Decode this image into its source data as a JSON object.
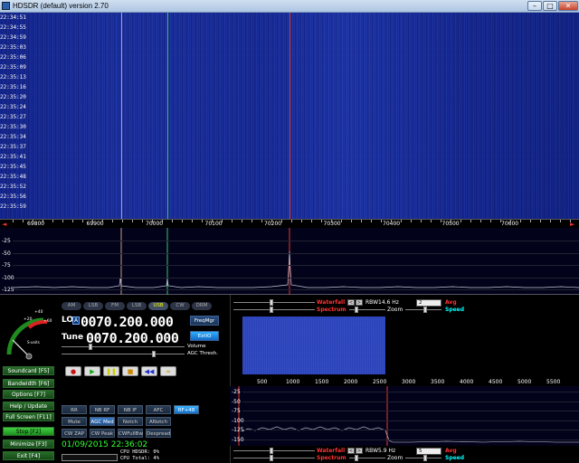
{
  "window": {
    "title": "HDSDR (default)  version 2.70"
  },
  "colors": {
    "waterfall_bg": "#0c1a74",
    "marker_tan": "#c19a7c",
    "marker_green": "#39c26a",
    "marker_red": "#e43a2a",
    "datetime_green": "#33ff33",
    "button_green": "#1d6b1f"
  },
  "waterfall": {
    "times": [
      "22:34:51",
      "22:34:55",
      "22:34:59",
      "22:35:03",
      "22:35:06",
      "22:35:09",
      "22:35:13",
      "22:35:16",
      "22:35:20",
      "22:35:24",
      "22:35:27",
      "22:35:30",
      "22:35:34",
      "22:35:37",
      "22:35:41",
      "22:35:45",
      "22:35:48",
      "22:35:52",
      "22:35:56",
      "22:35:59"
    ]
  },
  "freq_scale": {
    "labels": [
      "69800",
      "69900",
      "70000",
      "70100",
      "70200",
      "70300",
      "70400",
      "70500",
      "70600"
    ]
  },
  "spectrum": {
    "db_labels": [
      "-25",
      "-50",
      "-75",
      "-100",
      "-125"
    ]
  },
  "smeter": {
    "scale_labels": [
      "+20",
      "+40",
      "+60",
      "S-units"
    ]
  },
  "modes": [
    "AM",
    "LSB",
    "FM",
    "LSB",
    "USB",
    "CW",
    "DRM"
  ],
  "active_mode": "USB",
  "lo": {
    "label": "LO",
    "sub": "A",
    "value": "0070.200.000"
  },
  "tune": {
    "label": "Tune",
    "value": "0070.200.000"
  },
  "side_buttons": {
    "freqmgr": "FreqMgr",
    "ext_io": "ExtIO"
  },
  "sliders": {
    "volume": "Volume",
    "agc_thresh": "AGC Thresh."
  },
  "left_menu": [
    "Soundcard [F5]",
    "Bandwidth [F6]",
    "Options [F7]",
    "Help / Update [F1]",
    "Full Screen [F11]",
    "Stop [F2]",
    "Minimize [F3]",
    "Exit [F4]"
  ],
  "transport": [
    "record-icon",
    "play-icon",
    "pause-icon",
    "stop-icon",
    "rewind-icon",
    "loop-icon"
  ],
  "dsp_row1": [
    "RR",
    "NB RF",
    "NB IF",
    "AFC",
    "RF+48"
  ],
  "dsp_row2": [
    "Mute",
    "AGC Med",
    "Notch",
    "ANotch"
  ],
  "dsp_row3": [
    "CW ZAP",
    "CW Peak",
    "CWFullBw",
    "Despread"
  ],
  "datetime": "01/09/2015 22:36:02",
  "cpu": {
    "hdsdr": "CPU HDSDR: 0%",
    "total": "CPU Total: 4%"
  },
  "af_top": {
    "waterfall": "Waterfall",
    "spectrum": "Spectrum",
    "rbw_label": "RBW",
    "rbw_value": "14.6 Hz",
    "zoom": "Zoom",
    "avg_select": "2",
    "avg": "Avg",
    "speed": "Speed"
  },
  "af_freq_labels": [
    "500",
    "1000",
    "1500",
    "2000",
    "2500",
    "3000",
    "3500",
    "4000",
    "4500",
    "5000",
    "5500"
  ],
  "af_db_labels": [
    "-25",
    "-50",
    "-75",
    "-100",
    "-125",
    "-150"
  ],
  "af_bottom": {
    "waterfall": "Waterfall",
    "spectrum": "Spectrum",
    "rbw_label": "RBW",
    "rbw_value": "5.9 Hz",
    "zoom": "Zoom",
    "avg_select": "5",
    "avg": "Avg",
    "speed": "Speed"
  }
}
